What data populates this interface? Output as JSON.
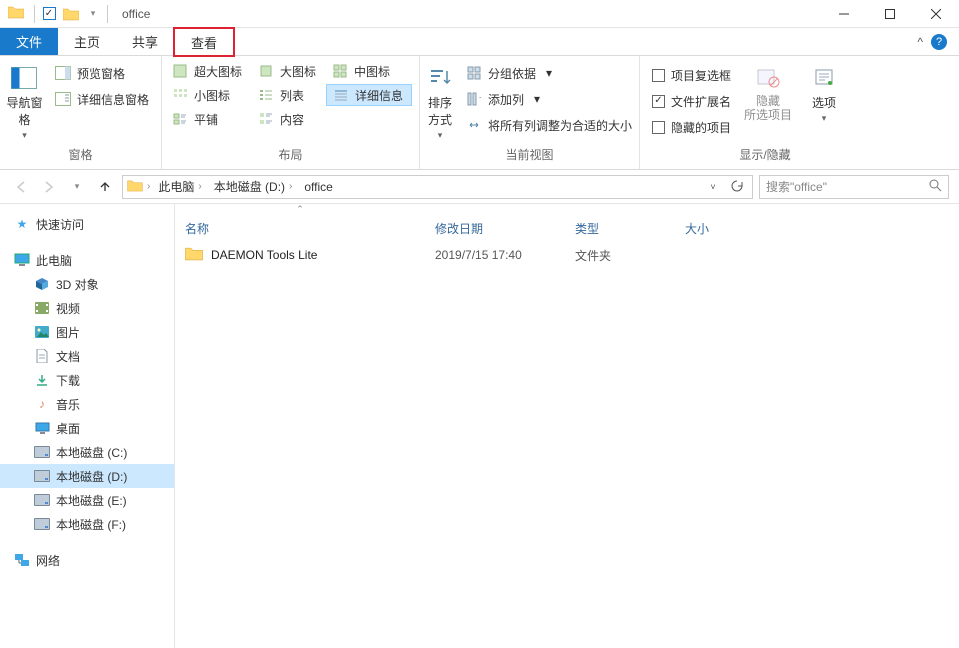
{
  "window": {
    "title": "office"
  },
  "tabs": {
    "file": "文件",
    "home": "主页",
    "share": "共享",
    "view": "查看"
  },
  "ribbon": {
    "panes": {
      "label": "窗格",
      "nav": "导航窗格",
      "preview": "预览窗格",
      "details": "详细信息窗格"
    },
    "layout": {
      "label": "布局",
      "xlarge": "超大图标",
      "large": "大图标",
      "medium": "中图标",
      "small": "小图标",
      "list": "列表",
      "details": "详细信息",
      "tiles": "平铺",
      "content": "内容"
    },
    "currentview": {
      "label": "当前视图",
      "sort": "排序方式",
      "group": "分组依据",
      "addcol": "添加列",
      "fitcols": "将所有列调整为合适的大小"
    },
    "showhide": {
      "label": "显示/隐藏",
      "checkboxes": "项目复选框",
      "extensions": "文件扩展名",
      "hiddenitems": "隐藏的项目",
      "hide": "隐藏\n所选项目",
      "options": "选项"
    }
  },
  "breadcrumbs": {
    "pc": "此电脑",
    "drive": "本地磁盘 (D:)",
    "folder": "office"
  },
  "search": {
    "placeholder": "搜索\"office\""
  },
  "sidebar": {
    "quick": "快速访问",
    "pc": "此电脑",
    "obj3d": "3D 对象",
    "videos": "视频",
    "pictures": "图片",
    "docs": "文档",
    "downloads": "下载",
    "music": "音乐",
    "desktop": "桌面",
    "c": "本地磁盘 (C:)",
    "d": "本地磁盘 (D:)",
    "e": "本地磁盘 (E:)",
    "f": "本地磁盘 (F:)",
    "network": "网络"
  },
  "columns": {
    "name": "名称",
    "date": "修改日期",
    "type": "类型",
    "size": "大小"
  },
  "files": [
    {
      "name": "DAEMON Tools Lite",
      "date": "2019/7/15 17:40",
      "type": "文件夹",
      "size": ""
    }
  ]
}
